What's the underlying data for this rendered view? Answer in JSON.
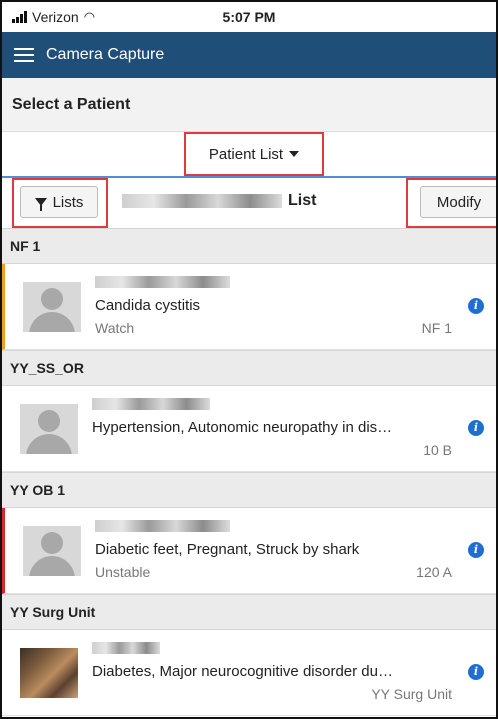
{
  "status_bar": {
    "carrier": "Verizon",
    "time": "5:07 PM"
  },
  "app": {
    "title": "Camera Capture"
  },
  "select_row": {
    "label": "Select a Patient"
  },
  "patient_list_dropdown": {
    "label": "Patient List"
  },
  "toolbar": {
    "lists_label": "Lists",
    "list_name_suffix": "List",
    "modify_label": "Modify"
  },
  "sections": [
    {
      "header": "NF 1",
      "patients": [
        {
          "problems": "Candida cystitis",
          "status": "Watch",
          "location": "NF 1",
          "flag": "orange"
        }
      ]
    },
    {
      "header": "YY_SS_OR",
      "patients": [
        {
          "problems": "Hypertension, Autonomic neuropathy in dis…",
          "status": "",
          "location": "10 B",
          "flag": ""
        }
      ]
    },
    {
      "header": "YY OB 1",
      "patients": [
        {
          "problems": "Diabetic feet, Pregnant, Struck by shark",
          "status": "Unstable",
          "location": "120 A",
          "flag": "red"
        }
      ]
    },
    {
      "header": "YY Surg Unit",
      "patients": [
        {
          "problems": "Diabetes, Major neurocognitive disorder du…",
          "status": "",
          "location": "YY Surg Unit",
          "flag": ""
        }
      ]
    }
  ],
  "colors": {
    "header_bg": "#1f4e79",
    "highlight_outline": "#e0393e",
    "info_icon": "#1f6fd1",
    "flag_orange": "#f0a020",
    "flag_red": "#d9262c"
  },
  "icons": {
    "menu": "hamburger-icon",
    "lists": "filter-icon",
    "info": "info-icon",
    "dropdown": "caret-down-icon"
  }
}
